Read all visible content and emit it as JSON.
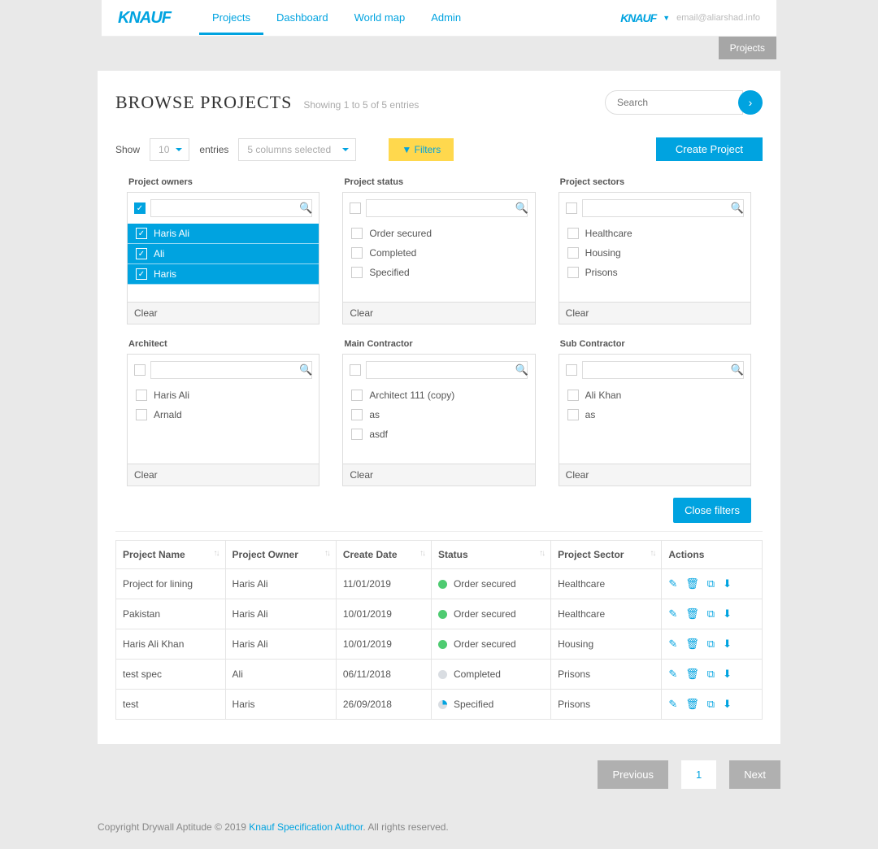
{
  "brand": "KNAUF",
  "nav": {
    "items": [
      "Projects",
      "Dashboard",
      "World map",
      "Admin"
    ],
    "active": 0
  },
  "user": {
    "email": "email@aliarshad.info"
  },
  "breadcrumb": "Projects",
  "page": {
    "title": "BROWSE PROJECTS",
    "entries_info": "Showing 1 to 5 of 5 entries",
    "search_placeholder": "Search",
    "show_label": "Show",
    "show_value": "10",
    "entries_label": "entries",
    "columns_select": "5 columns selected",
    "filters_btn": "▼ Filters",
    "create_btn": "Create Project",
    "close_filters": "Close filters",
    "clear": "Clear"
  },
  "filters": {
    "project_owners": {
      "label": "Project owners",
      "all_checked": true,
      "items": [
        {
          "label": "Haris Ali",
          "checked": true
        },
        {
          "label": "Ali",
          "checked": true
        },
        {
          "label": "Haris",
          "checked": true
        }
      ]
    },
    "project_status": {
      "label": "Project status",
      "all_checked": false,
      "items": [
        {
          "label": "Order secured",
          "checked": false
        },
        {
          "label": "Completed",
          "checked": false
        },
        {
          "label": "Specified",
          "checked": false
        }
      ]
    },
    "project_sectors": {
      "label": "Project sectors",
      "all_checked": false,
      "items": [
        {
          "label": "Healthcare",
          "checked": false
        },
        {
          "label": "Housing",
          "checked": false
        },
        {
          "label": "Prisons",
          "checked": false
        }
      ]
    },
    "architect": {
      "label": "Architect",
      "all_checked": false,
      "items": [
        {
          "label": "Haris Ali",
          "checked": false
        },
        {
          "label": "Arnald",
          "checked": false
        }
      ]
    },
    "main_contractor": {
      "label": "Main Contractor",
      "all_checked": false,
      "items": [
        {
          "label": "Architect 111 (copy)",
          "checked": false
        },
        {
          "label": "as",
          "checked": false
        },
        {
          "label": "asdf",
          "checked": false
        }
      ]
    },
    "sub_contractor": {
      "label": "Sub Contractor",
      "all_checked": false,
      "items": [
        {
          "label": "Ali Khan",
          "checked": false
        },
        {
          "label": "as",
          "checked": false
        }
      ]
    }
  },
  "table": {
    "columns": [
      "Project Name",
      "Project Owner",
      "Create Date",
      "Status",
      "Project Sector",
      "Actions"
    ],
    "rows": [
      {
        "name": "Project for lining",
        "owner": "Haris Ali",
        "date": "11/01/2019",
        "status": "Order secured",
        "status_kind": "green",
        "sector": "Healthcare"
      },
      {
        "name": "Pakistan",
        "owner": "Haris Ali",
        "date": "10/01/2019",
        "status": "Order secured",
        "status_kind": "green",
        "sector": "Healthcare"
      },
      {
        "name": "Haris Ali Khan",
        "owner": "Haris Ali",
        "date": "10/01/2019",
        "status": "Order secured",
        "status_kind": "green",
        "sector": "Housing"
      },
      {
        "name": "test spec",
        "owner": "Ali",
        "date": "06/11/2018",
        "status": "Completed",
        "status_kind": "grey",
        "sector": "Prisons"
      },
      {
        "name": "test",
        "owner": "Haris",
        "date": "26/09/2018",
        "status": "Specified",
        "status_kind": "half",
        "sector": "Prisons"
      }
    ]
  },
  "pagination": {
    "prev": "Previous",
    "current": "1",
    "next": "Next"
  },
  "footer": {
    "prefix": "Copyright Drywall Aptitude © 2019 ",
    "link": "Knauf Specification Author",
    "suffix": ". All rights reserved."
  }
}
